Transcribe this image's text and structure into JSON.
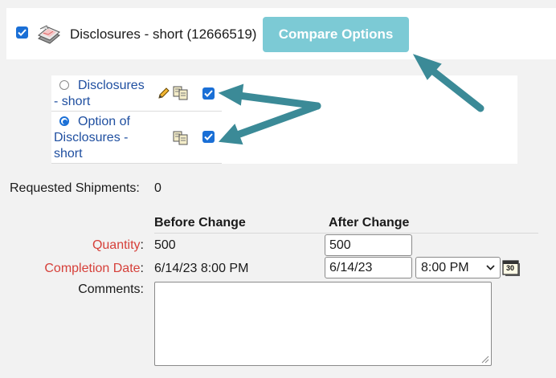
{
  "header": {
    "title": "Disclosures - short (12666519)",
    "compare_label": "Compare Options"
  },
  "options": [
    {
      "label_line1": "Disclosures",
      "label_line2": "- short",
      "selected": false,
      "checked": true
    },
    {
      "label_line1": "Option of",
      "label_line2": "Disclosures -",
      "label_line3": "short",
      "selected": true,
      "checked": true
    }
  ],
  "shipments": {
    "label": "Requested Shipments:",
    "value": "0"
  },
  "columns": {
    "before": "Before Change",
    "after": "After Change"
  },
  "fields": {
    "quantity_label": "Quantity",
    "quantity_colon": ":",
    "quantity_before": "500",
    "quantity_after": "500",
    "completion_label": "Completion Date",
    "completion_colon": ":",
    "completion_before": "6/14/23 8:00 PM",
    "completion_after_date": "6/14/23",
    "completion_after_time": "8:00 PM",
    "calendar_day": "30",
    "comments_label": "Comments:"
  },
  "colors": {
    "accent": "#1a6fd6",
    "compare_button": "#7ccad5",
    "required_label": "#d6403a",
    "option_link": "#1f4fa0",
    "annotation_arrow": "#3b8a97"
  }
}
